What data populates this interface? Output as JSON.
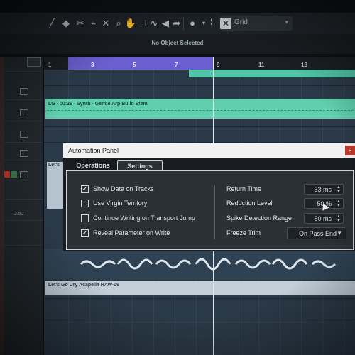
{
  "toolbar": {
    "grid_label": "Grid",
    "icons": [
      "line-tool-icon",
      "erase-icon",
      "scissors-icon",
      "glue-icon",
      "mute-icon",
      "zoom-icon",
      "hand-icon",
      "warp-icon",
      "speaker-icon",
      "arrow-icon",
      "color-icon",
      "snap-icon",
      "grid-icon"
    ]
  },
  "info_line": {
    "text": "No Object Selected"
  },
  "ruler": {
    "bars": [
      "1",
      "3",
      "5",
      "7",
      "9",
      "11",
      "13"
    ]
  },
  "tracks": {
    "synth_event_label": "LG - 00:26 - Synth - Gentle Arp Build Stem",
    "vocal_left_label": "Let's",
    "vocal_event_label": "Let's Go Dry Acapella RAW-09",
    "left_value": "2.52"
  },
  "dialog": {
    "title": "Automation Panel",
    "close_label": "×",
    "tabs": [
      {
        "label": "Operations",
        "active": false
      },
      {
        "label": "Settings",
        "active": true
      }
    ],
    "options": [
      {
        "label": "Show Data on Tracks",
        "checked": true
      },
      {
        "label": "Use Virgin Territory",
        "checked": false
      },
      {
        "label": "Continue Writing on Transport Jump",
        "checked": false
      },
      {
        "label": "Reveal Parameter on Write",
        "checked": true
      }
    ],
    "settings": [
      {
        "label": "Return Time",
        "value": "33 ms"
      },
      {
        "label": "Reduction Level",
        "value": "50 %"
      },
      {
        "label": "Spike Detection Range",
        "value": "50 ms"
      },
      {
        "label": "Freeze Trim",
        "value": "On Pass End"
      }
    ]
  },
  "colors": {
    "cycle": "#6a5fd0",
    "synth_event": "#5fcfad",
    "vocal_event": "#c3cfd9",
    "arrange_bg": "#2b3a48"
  }
}
